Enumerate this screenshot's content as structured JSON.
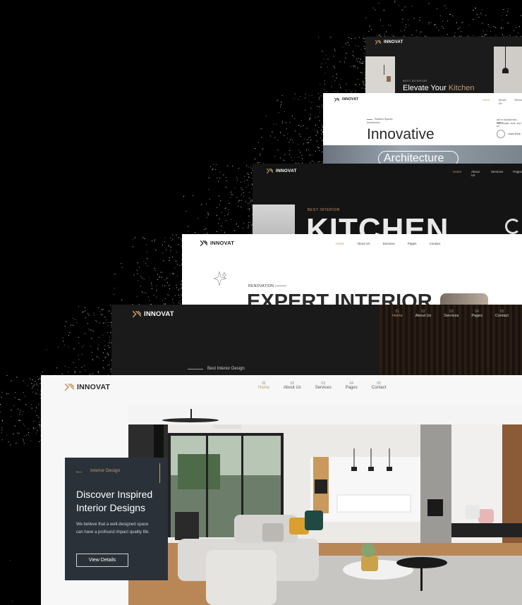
{
  "brand": {
    "name": "INNOVAT",
    "accent": "#c49a6c"
  },
  "card1": {
    "kicker": "BEST INTERIOR",
    "headline_prefix": "Elevate Your",
    "headline_accent": "Kitchen"
  },
  "card2": {
    "nav": [
      "Home",
      "About Us",
      "Servic"
    ],
    "small_line1": "Timeless Spaces",
    "small_line2": "Architecture",
    "headline": "Innovative",
    "pill_text": "Architecture",
    "right_text1": "we've transformed intern",
    "right_text2": "that people, work, and rel",
    "learn_more": "Learn More"
  },
  "card3": {
    "nav": [
      "Home",
      "About Us",
      "Services",
      "Pages"
    ],
    "kicker": "BEST INTERIOR",
    "headline": "KITCHEN"
  },
  "card4": {
    "nav": [
      "Home",
      "About Us",
      "Services",
      "Pages",
      "Contact"
    ],
    "kicker": "RENOVATION",
    "headline": "EXPERT INTERIOR"
  },
  "card5": {
    "nav": [
      {
        "num": "01",
        "label": "Home"
      },
      {
        "num": "02",
        "label": "About Us"
      },
      {
        "num": "03",
        "label": "Services"
      },
      {
        "num": "04",
        "label": "Pages"
      },
      {
        "num": "05",
        "label": "Contact"
      }
    ],
    "tagline": "Best Interior Design"
  },
  "card6": {
    "nav": [
      {
        "num": "01",
        "label": "Home"
      },
      {
        "num": "02",
        "label": "About Us"
      },
      {
        "num": "03",
        "label": "Services"
      },
      {
        "num": "04",
        "label": "Pages"
      },
      {
        "num": "05",
        "label": "Contact"
      }
    ],
    "panel": {
      "kicker": "Interior Design",
      "title_line1": "Discover Inspired",
      "title_line2": "Interior Designs",
      "body_line1": "We believe that a well-designed space",
      "body_line2": "can have a profound impact quality life.",
      "button": "View Details"
    }
  }
}
